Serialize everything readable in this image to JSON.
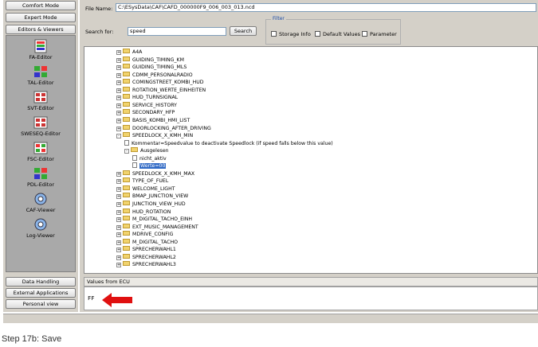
{
  "modes": [
    "Comfort Mode",
    "Expert Mode",
    "Editors & Viewers"
  ],
  "tools": [
    "FA-Editor",
    "TAL-Editor",
    "SVT-Editor",
    "SWESEQ-Editor",
    "FSC-Editor",
    "PDL-Editor",
    "CAF-Viewer",
    "Log-Viewer"
  ],
  "bottom_buttons": [
    "Data Handling",
    "External Applications",
    "Personal view"
  ],
  "file_label": "File Name:",
  "file_value": "C:\\ESysData\\CAF\\CAFD_000000F9_006_003_013.ncd",
  "search_label": "Search for:",
  "search_value": "speed",
  "search_button": "Search",
  "filter": {
    "legend": "Filter",
    "options": [
      "Storage Info",
      "Default Values",
      "Parameter"
    ]
  },
  "tree": [
    {
      "label": "A4A",
      "level": 0,
      "exp": "+"
    },
    {
      "label": "GUIDING_TIMING_KM",
      "level": 0,
      "exp": "+"
    },
    {
      "label": "GUIDING_TIMING_MLS",
      "level": 0,
      "exp": "+"
    },
    {
      "label": "CDMM_PERSONALRADIO",
      "level": 0,
      "exp": "+"
    },
    {
      "label": "COMINGSTREET_KOMBI_HUD",
      "level": 0,
      "exp": "+"
    },
    {
      "label": "ROTATION_WERTE_EINHEITEN",
      "level": 0,
      "exp": "+"
    },
    {
      "label": "HUD_TURNSIGNAL",
      "level": 0,
      "exp": "+"
    },
    {
      "label": "SERVICE_HISTORY",
      "level": 0,
      "exp": "+"
    },
    {
      "label": "SECONDARY_HFP",
      "level": 0,
      "exp": "+"
    },
    {
      "label": "BASIS_KOMBI_HMI_LIST",
      "level": 0,
      "exp": "+"
    },
    {
      "label": "DOORLOCKING_AFTER_DRIVING",
      "level": 0,
      "exp": "+"
    },
    {
      "label": "SPEEDLOCK_X_KMH_MIN",
      "level": 0,
      "exp": "-"
    },
    {
      "label": "Kommentar=Speedvalue to deactivate Speedlock (if speed falls below this value)",
      "level": 1,
      "doc": true
    },
    {
      "label": "Ausgelesen",
      "level": 1,
      "exp": "-"
    },
    {
      "label": "nicht_aktiv",
      "level": 2,
      "doc": true
    },
    {
      "label": "Werte=00",
      "level": 2,
      "doc": true,
      "selected": true
    },
    {
      "label": "SPEEDLOCK_X_KMH_MAX",
      "level": 0,
      "exp": "+"
    },
    {
      "label": "TYPE_OF_FUEL",
      "level": 0,
      "exp": "+"
    },
    {
      "label": "WELCOME_LIGHT",
      "level": 0,
      "exp": "+"
    },
    {
      "label": "BMAP_JUNCTION_VIEW",
      "level": 0,
      "exp": "+"
    },
    {
      "label": "JUNCTION_VIEW_HUD",
      "level": 0,
      "exp": "+"
    },
    {
      "label": "HUD_ROTATION",
      "level": 0,
      "exp": "+"
    },
    {
      "label": "M_DIGITAL_TACHO_EINH",
      "level": 0,
      "exp": "+"
    },
    {
      "label": "EXT_MUSIC_MANAGEMENT",
      "level": 0,
      "exp": "+"
    },
    {
      "label": "MDRIVE_CONFIG",
      "level": 0,
      "exp": "+"
    },
    {
      "label": "M_DIGITAL_TACHO",
      "level": 0,
      "exp": "+"
    },
    {
      "label": "SPRECHERWAHL1",
      "level": 0,
      "exp": "+"
    },
    {
      "label": "SPRECHERWAHL2",
      "level": 0,
      "exp": "+"
    },
    {
      "label": "SPRECHERWAHL3",
      "level": 0,
      "exp": "+"
    }
  ],
  "values_header": "Values from ECU",
  "values_value": "FF",
  "caption": "Step 17b: Save"
}
